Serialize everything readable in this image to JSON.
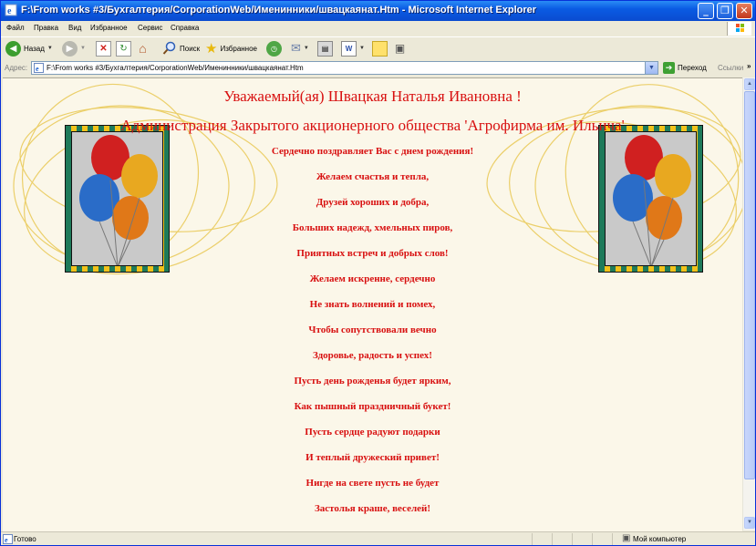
{
  "window": {
    "title": "F:\\From works #3/Бухгалтерия/CorporationWeb/Именинники/швацкаянат.Htm - Microsoft Internet Explorer",
    "minimize": "_",
    "restore": "❐",
    "close": "✕"
  },
  "menu": [
    "Файл",
    "Правка",
    "Вид",
    "Избранное",
    "Сервис",
    "Справка"
  ],
  "toolbar": {
    "back": "Назад",
    "search": "Поиск",
    "favorites": "Избранное"
  },
  "address": {
    "label": "Адрес:",
    "value": "F:\\From works #3/Бухгалтерия/CorporationWeb/Именинники/швацкаянат.Htm",
    "go": "Переход",
    "links": "Ссылки"
  },
  "page": {
    "greeting": "Уважаемый(ая) Швацкая Наталья Ивановна !",
    "company": "Администрация Закрытого акционерного общества 'Агрофирма им. Ильича'",
    "lines": [
      "Сердечно поздравляет Вас с днем рождения!",
      "Желаем счастья и тепла,",
      "Друзей хороших и добра,",
      "Больших надежд, хмельных пиров,",
      "Приятных встреч и добрых слов!",
      "Желаем искренне, сердечно",
      "Не знать волнений и помех,",
      "Чтобы сопутствовали вечно",
      "Здоровье, радость и успех!",
      "Пусть день рожденья будет ярким,",
      "Как пышный праздничный букет!",
      "Пусть сердце радуют подарки",
      "И теплый дружеский привет!",
      "Нигде на свете пусть не будет",
      "Застолья краше, веселей!"
    ]
  },
  "status": {
    "text": "Готово",
    "zone": "Мой компьютер"
  },
  "colors": {
    "text_red": "#D81010",
    "page_bg": "#FBF7E9",
    "title_blue": "#0A5BE3"
  }
}
